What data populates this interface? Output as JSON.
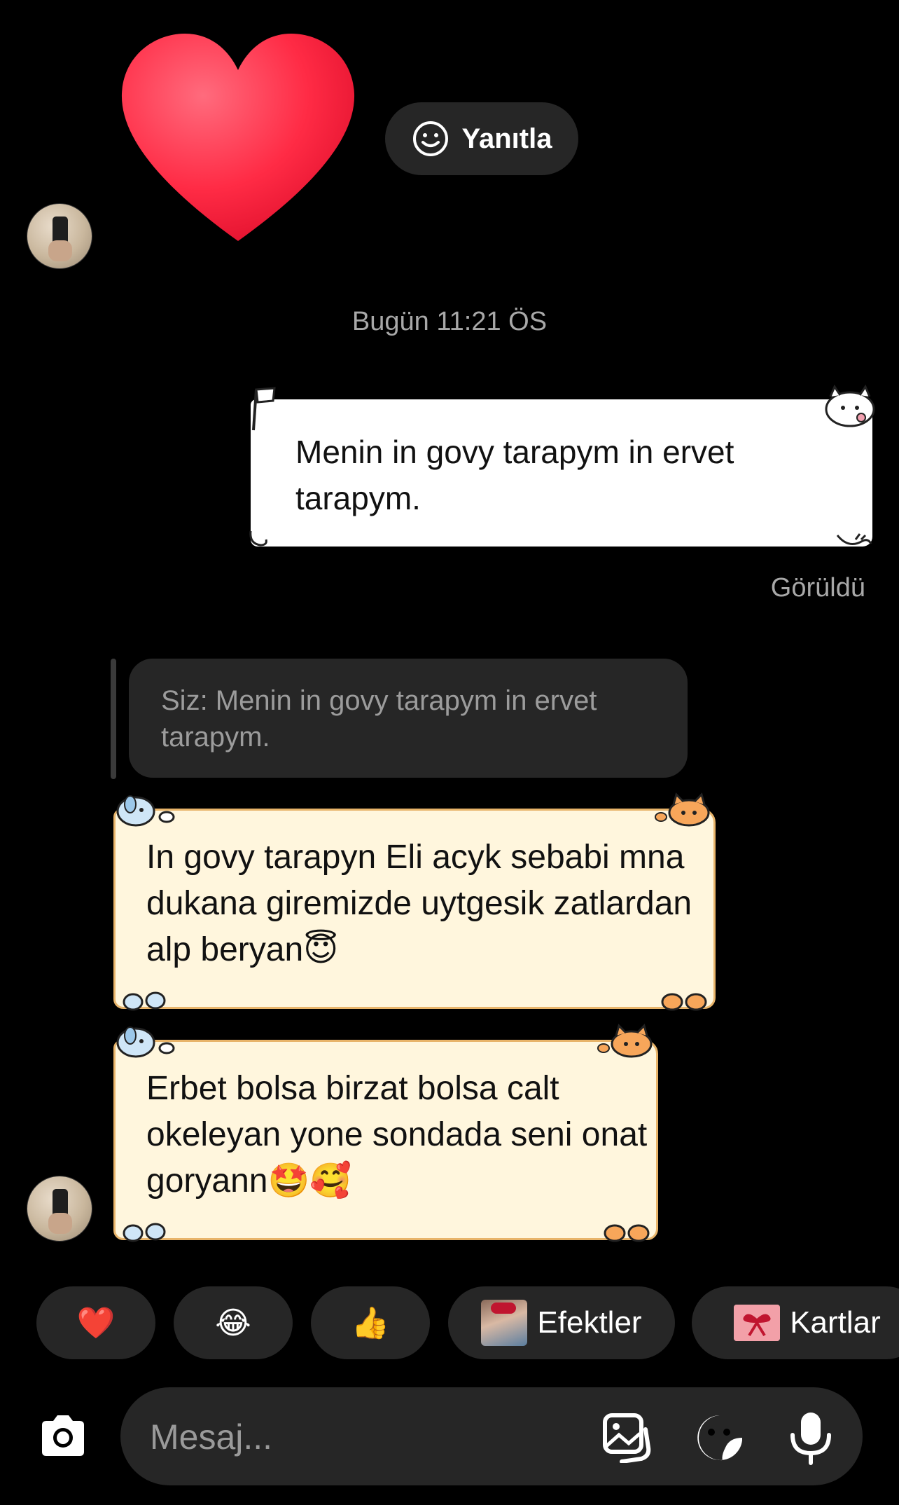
{
  "reaction_bar": {
    "reply_label": "Yanıtla"
  },
  "chat": {
    "timestamp": "Bugün 11:21 ÖS",
    "outgoing_message": "Menin in govy tarapym in ervet tarapym.",
    "seen_status": "Görüldü",
    "quoted_reply": "Siz: Menin in govy tarapym in ervet tarapym.",
    "incoming_messages": [
      "In govy tarapyn Eli acyk sebabi mna dukana giremizde uytgesik zatlardan alp beryan😇",
      "Erbet bolsa birzat bolsa calt okeleyan yone sondada seni onat goryann🤩🥰"
    ]
  },
  "quick_reactions": {
    "heart": "❤️",
    "laugh": "😂",
    "thumbs_up": "👍",
    "effects_label": "Efektler",
    "cards_label": "Kartlar"
  },
  "composer": {
    "placeholder": "Mesaj..."
  },
  "colors": {
    "background": "#000000",
    "pill": "#262626",
    "note_bubble": "#fff6dd",
    "note_border": "#e8b46a",
    "heart": "#ff2d46"
  }
}
